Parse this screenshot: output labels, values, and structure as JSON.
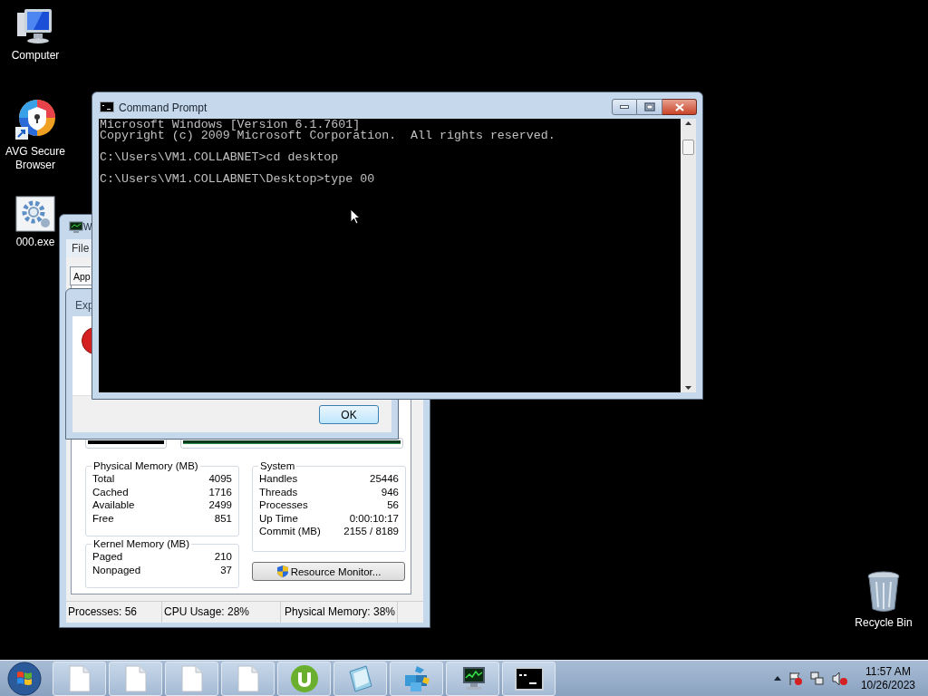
{
  "desktop_icons": [
    {
      "kind": "computer",
      "label": "Computer"
    },
    {
      "kind": "browser",
      "label": "AVG Secure Browser"
    },
    {
      "kind": "setup",
      "label": "000.exe"
    }
  ],
  "recycle_bin": {
    "label": "Recycle Bin"
  },
  "task_manager": {
    "title": "W",
    "menu": [
      "File"
    ],
    "tab": "App",
    "physical_memory": {
      "title": "Physical Memory (MB)",
      "rows": [
        {
          "label": "Total",
          "value": "4095"
        },
        {
          "label": "Cached",
          "value": "1716"
        },
        {
          "label": "Available",
          "value": "2499"
        },
        {
          "label": "Free",
          "value": "851"
        }
      ]
    },
    "kernel_memory": {
      "title": "Kernel Memory (MB)",
      "rows": [
        {
          "label": "Paged",
          "value": "210"
        },
        {
          "label": "Nonpaged",
          "value": "37"
        }
      ]
    },
    "system": {
      "title": "System",
      "rows": [
        {
          "label": "Handles",
          "value": "25446"
        },
        {
          "label": "Threads",
          "value": "946"
        },
        {
          "label": "Processes",
          "value": "56"
        },
        {
          "label": "Up Time",
          "value": "0:00:10:17"
        },
        {
          "label": "Commit (MB)",
          "value": "2155 / 8189"
        }
      ]
    },
    "resource_monitor_button": "Resource Monitor...",
    "status_bar": [
      "Processes: 56",
      "CPU Usage: 28%",
      "Physical Memory: 38%"
    ]
  },
  "error_dialog": {
    "title": "Exp",
    "button": "OK"
  },
  "command_prompt": {
    "title": "Command Prompt",
    "blocks": [
      [
        "Microsoft Windows [Version 6.1.7601]",
        "Copyright (c) 2009 Microsoft Corporation.  All rights reserved."
      ],
      [
        "C:\\Users\\VM1.COLLABNET>cd desktop"
      ],
      [
        "C:\\Users\\VM1.COLLABNET\\Desktop>type 00"
      ]
    ]
  },
  "taskbar": {
    "buttons": [
      {
        "kind": "document"
      },
      {
        "kind": "document"
      },
      {
        "kind": "document"
      },
      {
        "kind": "document"
      },
      {
        "kind": "torrent"
      },
      {
        "kind": "notepad"
      },
      {
        "kind": "installer"
      },
      {
        "kind": "monitor"
      },
      {
        "kind": "console"
      }
    ],
    "time": "11:57 AM",
    "date": "10/26/2023"
  }
}
